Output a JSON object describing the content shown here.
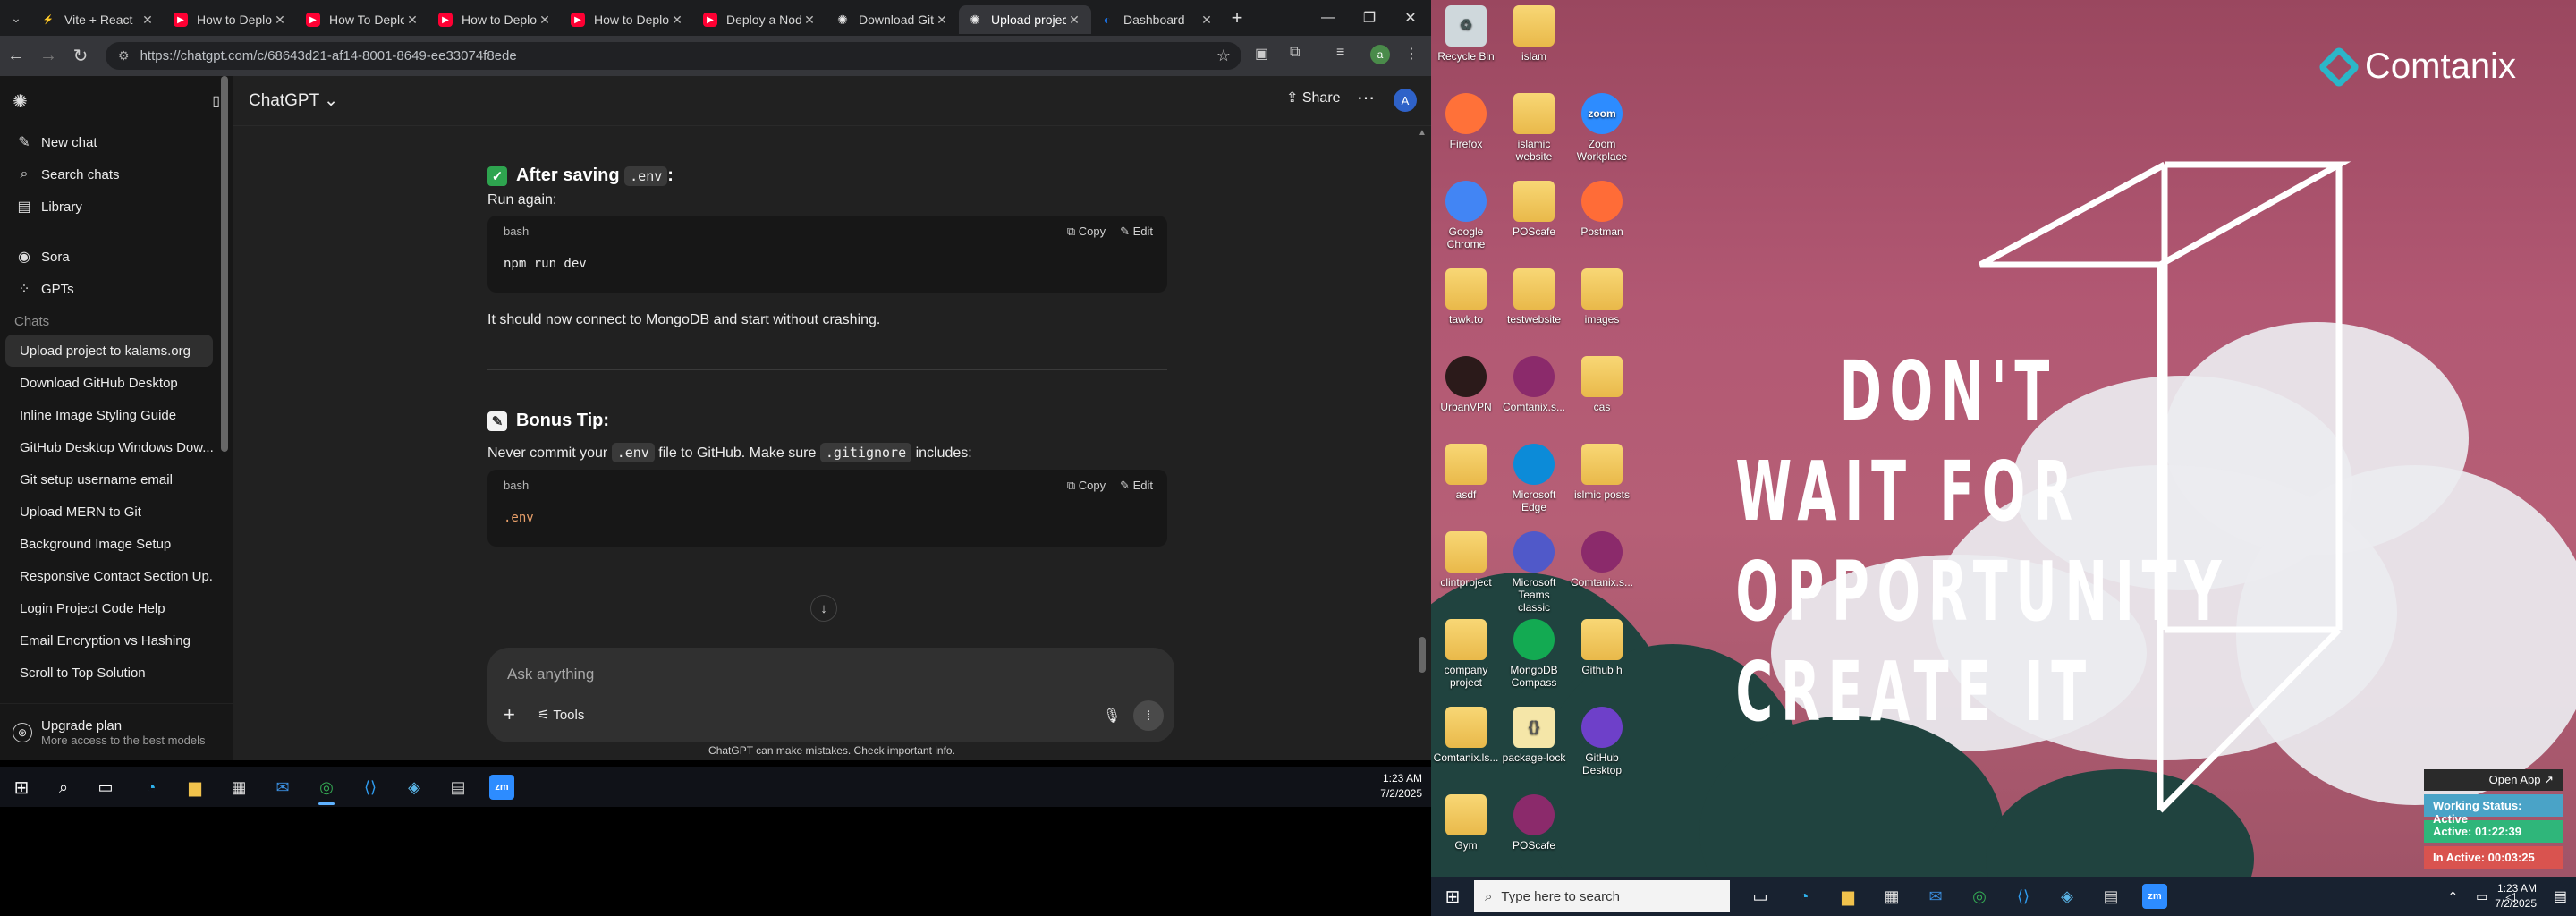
{
  "browser": {
    "tabs": [
      {
        "title": "Vite + React",
        "favicon_color": "#8a5cf6",
        "icon": "vite-icon"
      },
      {
        "title": "How to Deploy",
        "favicon_color": "#ff0033",
        "icon": "youtube-icon"
      },
      {
        "title": "How To Deploy",
        "favicon_color": "#ff0033",
        "icon": "youtube-icon"
      },
      {
        "title": "How to Deploy",
        "favicon_color": "#ff0033",
        "icon": "youtube-icon"
      },
      {
        "title": "How to Deploy",
        "favicon_color": "#ff0033",
        "icon": "youtube-icon"
      },
      {
        "title": "Deploy a Node",
        "favicon_color": "#ff0033",
        "icon": "youtube-icon"
      },
      {
        "title": "Download GitH",
        "favicon_color": "#ececec",
        "icon": "chatgpt-icon"
      },
      {
        "title": "Upload project",
        "favicon_color": "#ececec",
        "icon": "chatgpt-icon"
      },
      {
        "title": "Dashboard",
        "favicon_color": "#1a73e8",
        "icon": "dashboard-icon"
      }
    ],
    "active_tab": 7,
    "url": "https://chatgpt.com/c/68643d21-af14-8001-8649-ee33074f8ede",
    "profile_initial": "a"
  },
  "sidebar": {
    "top_items": [
      {
        "label": "New chat",
        "icon": "new-chat-icon"
      },
      {
        "label": "Search chats",
        "icon": "search-icon"
      },
      {
        "label": "Library",
        "icon": "library-icon"
      }
    ],
    "mid_items": [
      {
        "label": "Sora",
        "icon": "sora-icon"
      },
      {
        "label": "GPTs",
        "icon": "gpts-icon"
      }
    ],
    "section_title": "Chats",
    "chats": [
      "Upload project to kalams.org",
      "Download GitHub Desktop",
      "Inline Image Styling Guide",
      "GitHub Desktop Windows Dow...",
      "Git setup username email",
      "Upload MERN to Git",
      "Background Image Setup",
      "Responsive Contact Section Up...",
      "Login Project Code Help",
      "Email Encryption vs Hashing",
      "Scroll to Top Solution"
    ],
    "active_chat": 0,
    "upgrade_title": "Upgrade plan",
    "upgrade_sub": "More access to the best models"
  },
  "chat": {
    "model": "ChatGPT",
    "share_label": "Share",
    "avatar_initial": "A",
    "section1": {
      "title_prefix": "After saving",
      "title_code": ".env",
      "title_suffix": ":",
      "emoji_color": "#2ea44f"
    },
    "run_again": "Run again:",
    "code1": {
      "lang": "bash",
      "copy": "Copy",
      "edit": "Edit",
      "code": "npm run dev"
    },
    "after_code1": "It should now connect to MongoDB and start without crashing.",
    "section2": {
      "title": "Bonus Tip:",
      "emoji_color": "#f2f2f2"
    },
    "tip_parts": [
      "Never commit your",
      ".env",
      "file to GitHub. Make sure",
      ".gitignore",
      "includes:"
    ],
    "code2": {
      "lang": "bash",
      "copy": "Copy",
      "edit": "Edit",
      "code": ".env",
      "code_color": "#e9a06a"
    },
    "composer_placeholder": "Ask anything",
    "tools_label": "Tools",
    "disclaimer": "ChatGPT can make mistakes. Check important info."
  },
  "left_taskbar": {
    "time": "1:23 AM",
    "date": "7/2/2025",
    "apps": [
      "windows-start-icon",
      "search-icon",
      "task-view-icon",
      "edge-icon",
      "file-explorer-icon",
      "store-icon",
      "mail-icon",
      "chrome-icon",
      "vscode-icon",
      "app-icon",
      "app-icon",
      "zoom-icon"
    ]
  },
  "desktop": {
    "brand": "Comtanix",
    "quote_lines": [
      "DON'T",
      "WAIT FOR",
      "OPPORTUNITY",
      "CREATE IT"
    ],
    "icons": [
      {
        "label": "Recycle Bin",
        "kind": "recycle",
        "color": "#cfd8dc"
      },
      {
        "label": "islam",
        "kind": "folder"
      },
      {
        "label": "Firefox",
        "kind": "app",
        "color": "#ff7139"
      },
      {
        "label": "islamic website",
        "kind": "folder"
      },
      {
        "label": "Zoom Workplace",
        "kind": "app",
        "color": "#2d8cff",
        "glyph": "zoom"
      },
      {
        "label": "Google Chrome",
        "kind": "app",
        "color": "#4285f4"
      },
      {
        "label": "POScafe",
        "kind": "folder"
      },
      {
        "label": "Postman",
        "kind": "app",
        "color": "#ff6c37"
      },
      {
        "label": "tawk.to",
        "kind": "folder"
      },
      {
        "label": "testwebsite",
        "kind": "folder"
      },
      {
        "label": "images",
        "kind": "folder"
      },
      {
        "label": "UrbanVPN",
        "kind": "app",
        "color": "#2b1a1a"
      },
      {
        "label": "Comtanix.s...",
        "kind": "app",
        "color": "#8b2a6b"
      },
      {
        "label": "cas",
        "kind": "folder"
      },
      {
        "label": "asdf",
        "kind": "folder"
      },
      {
        "label": "Microsoft Edge",
        "kind": "app",
        "color": "#0c8bd8"
      },
      {
        "label": "islmic posts",
        "kind": "folder"
      },
      {
        "label": "clintproject",
        "kind": "folder"
      },
      {
        "label": "Microsoft Teams classic",
        "kind": "app",
        "color": "#5059c9"
      },
      {
        "label": "Comtanix.s...",
        "kind": "app",
        "color": "#8b2a6b"
      },
      {
        "label": "company project",
        "kind": "folder"
      },
      {
        "label": "MongoDB Compass",
        "kind": "app",
        "color": "#13aa52"
      },
      {
        "label": "Github h",
        "kind": "folder"
      },
      {
        "label": "Comtanix.ls...",
        "kind": "folder"
      },
      {
        "label": "package-lock",
        "kind": "file",
        "color": "#f5e6a8",
        "glyph": "{}"
      },
      {
        "label": "GitHub Desktop",
        "kind": "app",
        "color": "#6e40c9"
      },
      {
        "label": "Gym",
        "kind": "folder"
      },
      {
        "label": "POScafe",
        "kind": "app",
        "color": "#8b2a6b"
      }
    ],
    "status_widget": {
      "open_label": "Open App",
      "rows": [
        {
          "text": "Working Status: Active",
          "color": "#4aa3c7"
        },
        {
          "text": "Active: 01:22:39",
          "color": "#2fb67a"
        },
        {
          "text": "In Active: 00:03:25",
          "color": "#d9534f"
        }
      ]
    }
  },
  "right_taskbar": {
    "search_placeholder": "Type here to search",
    "time": "1:23 AM",
    "date": "7/2/2025"
  }
}
